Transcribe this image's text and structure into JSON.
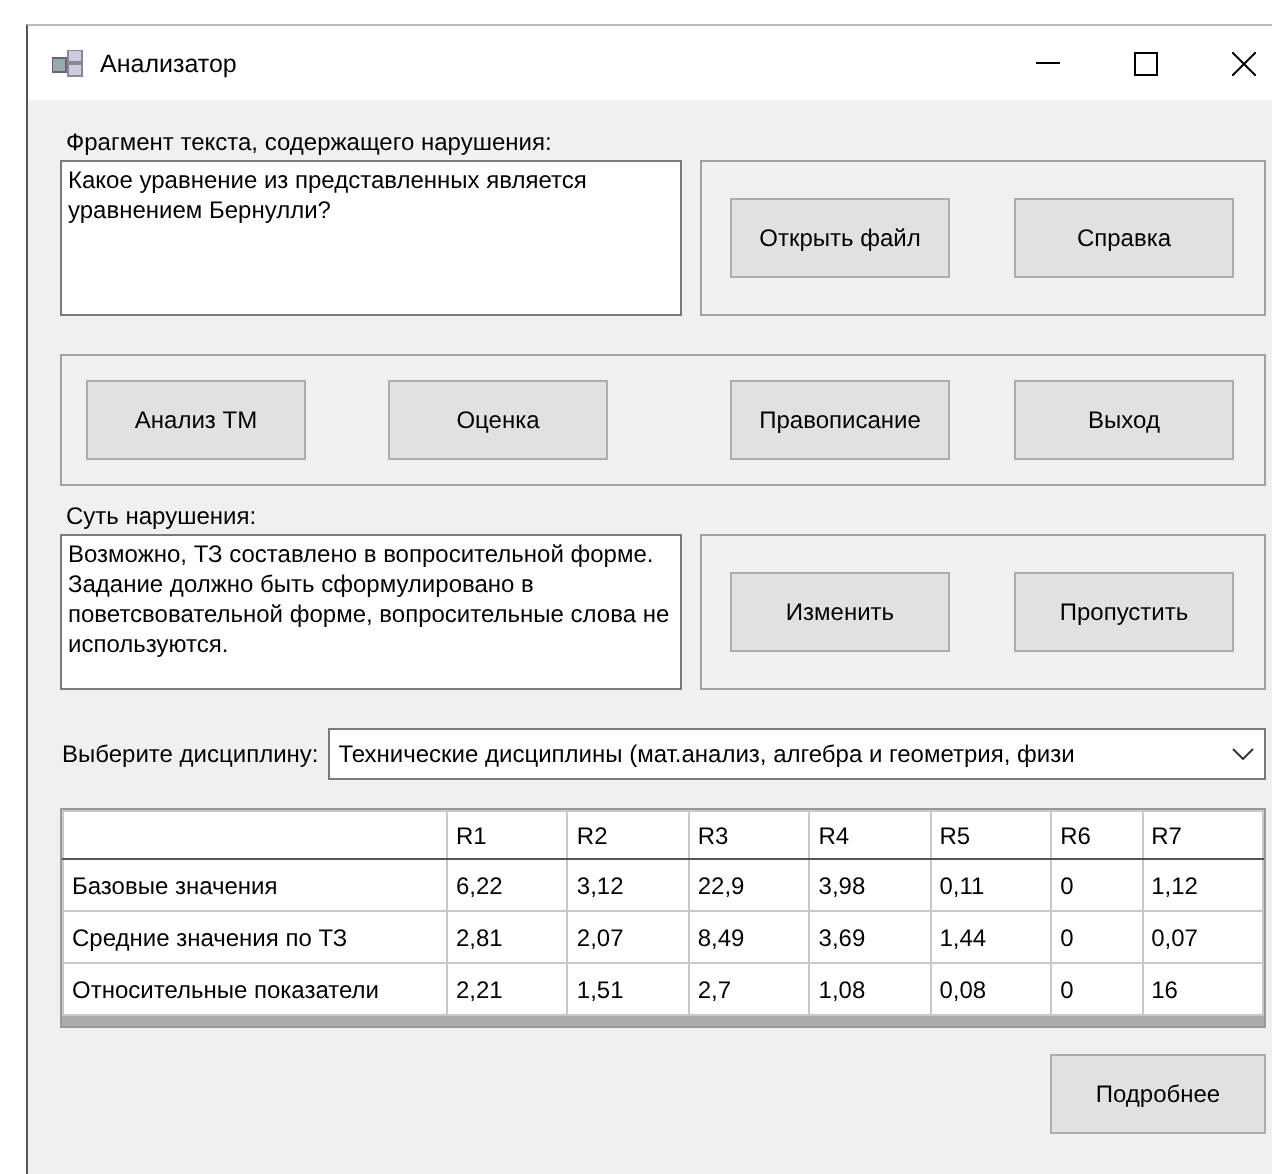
{
  "window": {
    "title": "Анализатор"
  },
  "fragment": {
    "label": "Фрагмент текста, содержащего нарушения:",
    "value": "Какое уравнение из представленных является уравнением Бернулли?"
  },
  "top_buttons": [
    "Открыть файл",
    "Справка"
  ],
  "action_buttons": [
    "Анализ ТМ",
    "Оценка",
    "Правописание",
    "Выход"
  ],
  "issue": {
    "label": "Суть нарушения:",
    "value": "Возможно, ТЗ составлено в вопросительной форме. Задание должно быть сформулировано в поветсвовательной форме, вопросительные слова не используются."
  },
  "issue_buttons": [
    "Изменить",
    "Пропустить"
  ],
  "discipline": {
    "label": "Выберите дисциплину:",
    "value": "Технические дисциплины (мат.анализ, алгебра и геометрия, физи"
  },
  "table": {
    "columns": [
      "R1",
      "R2",
      "R3",
      "R4",
      "R5",
      "R6",
      "R7"
    ],
    "rows": [
      {
        "name": "Базовые значения",
        "values": [
          "6,22",
          "3,12",
          "22,9",
          "3,98",
          "0,11",
          "0",
          "1,12"
        ]
      },
      {
        "name": "Средние значения по ТЗ",
        "values": [
          "2,81",
          "2,07",
          "8,49",
          "3,69",
          "1,44",
          "0",
          "0,07"
        ]
      },
      {
        "name": "Относительные показатели",
        "values": [
          "2,21",
          "1,51",
          "2,7",
          "1,08",
          "0,08",
          "0",
          "16"
        ]
      }
    ]
  },
  "details_button": "Подробнее"
}
